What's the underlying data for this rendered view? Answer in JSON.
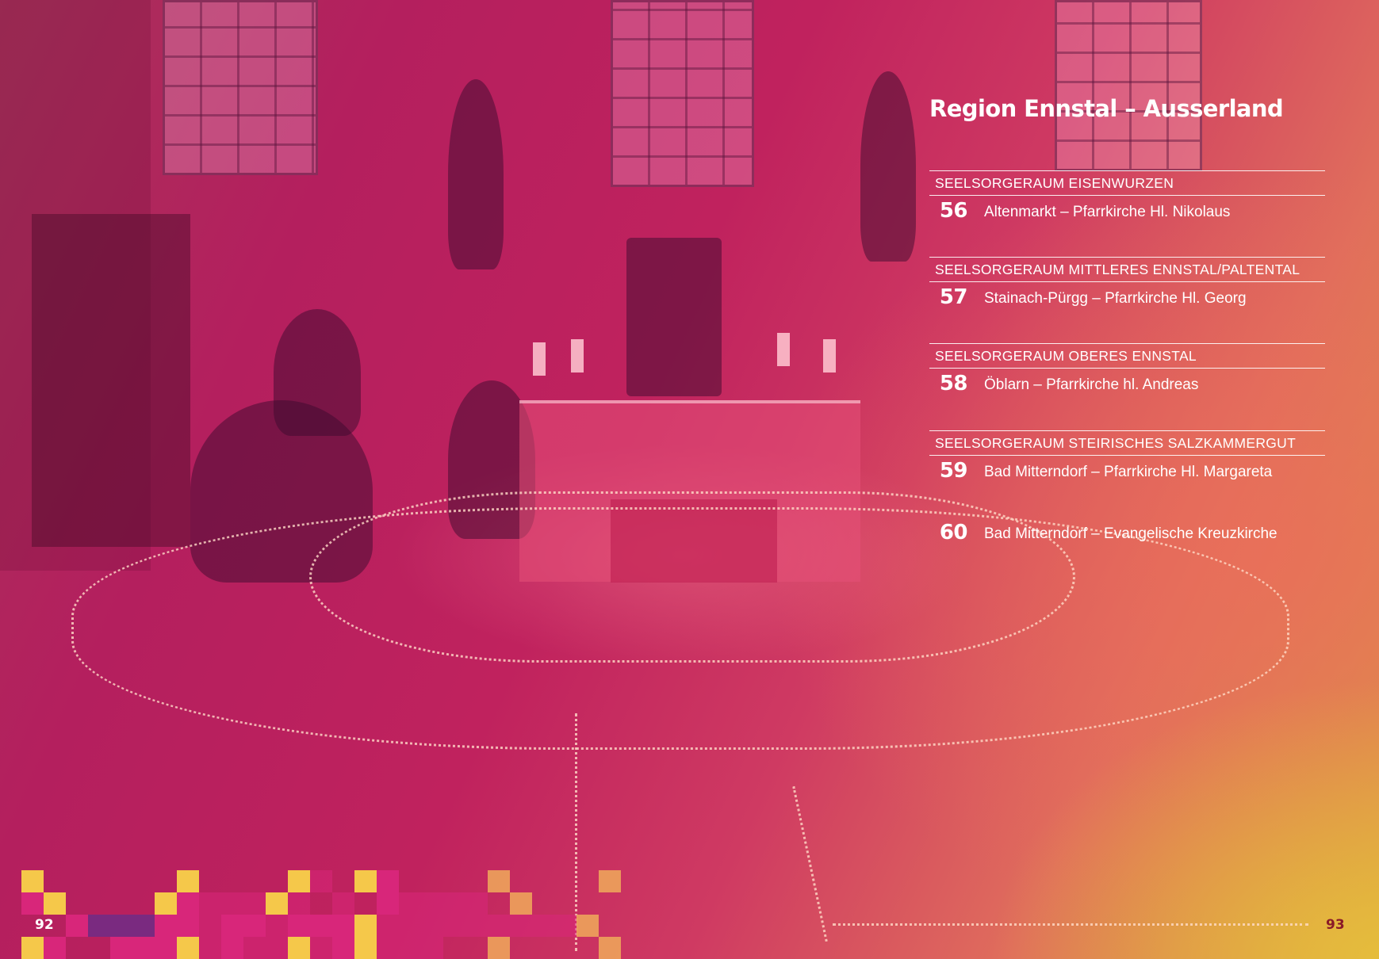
{
  "region_title": "Region Ennstal – Ausserland",
  "groups": [
    {
      "heading": "SEELSORGERAUM EISENWURZEN",
      "entries": [
        {
          "number": "56",
          "text": "Altenmarkt – Pfarrkirche Hl. Nikolaus"
        }
      ]
    },
    {
      "heading": "SEELSORGERAUM MITTLERES ENNSTAL/PALTENTAL",
      "entries": [
        {
          "number": "57",
          "text": "Stainach-Pürgg – Pfarrkirche Hl. Georg"
        }
      ]
    },
    {
      "heading": "SEELSORGERAUM OBERES ENNSTAL",
      "entries": [
        {
          "number": "58",
          "text": "Öblarn – Pfarrkirche hl. Andreas"
        }
      ]
    },
    {
      "heading": "SEELSORGERAUM STEIRISCHES SALZKAMMERGUT",
      "entries": [
        {
          "number": "59",
          "text": "Bad Mitterndorf – Pfarrkirche Hl. Margareta"
        },
        {
          "number": "60",
          "text": "Bad Mitterndorf – Evangelische Kreuzkirche"
        }
      ]
    }
  ],
  "page_numbers": {
    "left": "92",
    "right": "93"
  },
  "colors": {
    "magenta": "#c0225e",
    "orange": "#e06e5c",
    "yellow": "#f5c84a",
    "right_page_number": "#8a1a28"
  }
}
